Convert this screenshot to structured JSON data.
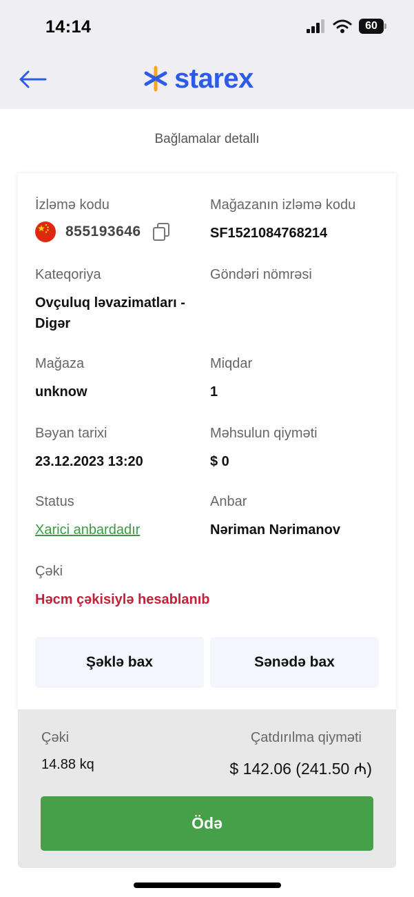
{
  "status_bar": {
    "time": "14:14",
    "battery": "60"
  },
  "header": {
    "logo_text": "starex",
    "subtitle": "Bağlamalar detallı"
  },
  "details": {
    "tracking_code": {
      "label": "İzləmə kodu",
      "value": "855193646"
    },
    "store_tracking_code": {
      "label": "Mağazanın izləmə kodu",
      "value": "SF1521084768214"
    },
    "category": {
      "label": "Kateqoriya",
      "value": "Ovçuluq ləvazimatları - Digər"
    },
    "shipment_number": {
      "label": "Göndəri nömrəsi",
      "value": ""
    },
    "store": {
      "label": "Mağaza",
      "value": "unknow"
    },
    "quantity": {
      "label": "Miqdar",
      "value": "1"
    },
    "declaration_date": {
      "label": "Bəyan tarixi",
      "value": "23.12.2023 13:20"
    },
    "product_price": {
      "label": "Məhsulun qiyməti",
      "value": "$ 0"
    },
    "status": {
      "label": "Status",
      "value": "Xarici anbardadır"
    },
    "warehouse": {
      "label": "Anbar",
      "value": "Nəriman Nərimanov"
    },
    "weight": {
      "label": "Çəki",
      "value": "Həcm çəkisiylə hesablanıb"
    },
    "view_photo_button": "Şəklə bax",
    "view_document_button": "Sənədə bax"
  },
  "footer": {
    "weight_label": "Çəki",
    "weight_value": "14.88 kq",
    "delivery_label": "Çatdırılma qiyməti",
    "delivery_value": "$ 142.06 (241.50 ₼)",
    "pay_button": "Ödə"
  },
  "colors": {
    "brand_blue": "#2c5be6",
    "brand_orange": "#f5a623",
    "status_green": "#3a9a42",
    "alert_red": "#c5203a",
    "pay_green": "#45a049"
  }
}
